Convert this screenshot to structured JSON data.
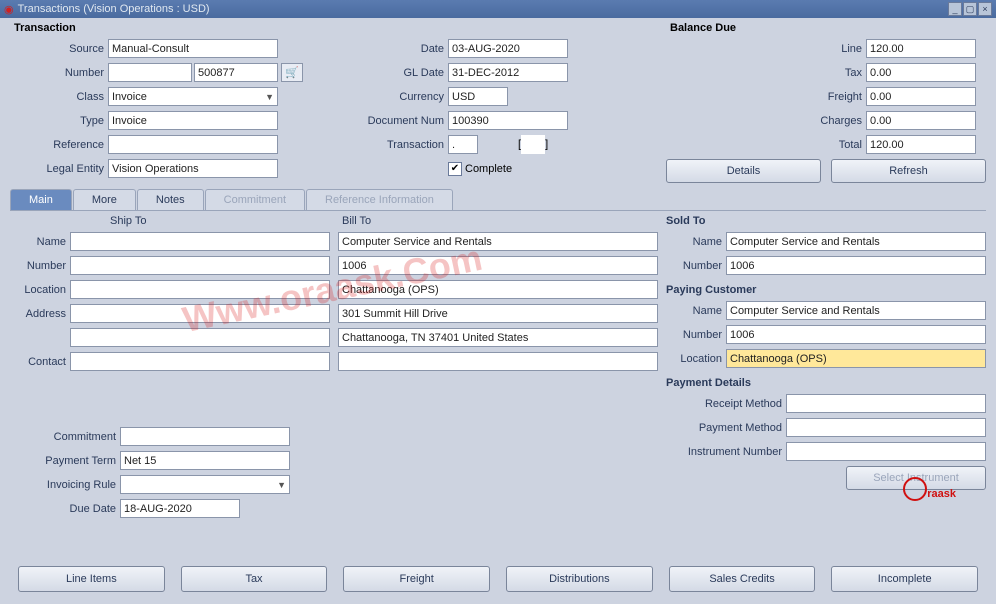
{
  "window": {
    "title": "Transactions (Vision Operations : USD)"
  },
  "transaction": {
    "label": "Transaction",
    "source_label": "Source",
    "source": "Manual-Consult",
    "number_label": "Number",
    "number_a": "",
    "number_b": "500877",
    "class_label": "Class",
    "class": "Invoice",
    "type_label": "Type",
    "type": "Invoice",
    "reference_label": "Reference",
    "reference": "",
    "legal_entity_label": "Legal Entity",
    "legal_entity": "Vision Operations",
    "date_label": "Date",
    "date": "03-AUG-2020",
    "gl_date_label": "GL Date",
    "gl_date": "31-DEC-2012",
    "currency_label": "Currency",
    "currency": "USD",
    "doc_num_label": "Document Num",
    "doc_num": "100390",
    "trans_label": "Transaction",
    "trans_a": ".",
    "trans_b": "",
    "complete_label": "Complete"
  },
  "balance": {
    "label": "Balance Due",
    "line_label": "Line",
    "line": "120.00",
    "tax_label": "Tax",
    "tax": "0.00",
    "freight_label": "Freight",
    "freight": "0.00",
    "charges_label": "Charges",
    "charges": "0.00",
    "total_label": "Total",
    "total": "120.00",
    "details_btn": "Details",
    "refresh_btn": "Refresh"
  },
  "tabs": {
    "main": "Main",
    "more": "More",
    "notes": "Notes",
    "commitment": "Commitment",
    "reference": "Reference Information"
  },
  "ship_to": {
    "header": "Ship To",
    "name_label": "Name",
    "name": "",
    "number_label": "Number",
    "number": "",
    "location_label": "Location",
    "location": "",
    "address_label": "Address",
    "address1": "",
    "address2": "",
    "contact_label": "Contact",
    "contact": ""
  },
  "bill_to": {
    "header": "Bill To",
    "name": "Computer Service and Rentals",
    "number": "1006",
    "location": "Chattanooga (OPS)",
    "address1": "301 Summit Hill Drive",
    "address2": "Chattanooga, TN 37401 United States",
    "contact": ""
  },
  "sold_to": {
    "label": "Sold To",
    "name_label": "Name",
    "name": "Computer Service and Rentals",
    "number_label": "Number",
    "number": "1006"
  },
  "paying": {
    "label": "Paying Customer",
    "name_label": "Name",
    "name": "Computer Service and Rentals",
    "number_label": "Number",
    "number": "1006",
    "location_label": "Location",
    "location": "Chattanooga (OPS)"
  },
  "payment_details": {
    "label": "Payment Details",
    "receipt_label": "Receipt Method",
    "receipt": "",
    "payment_label": "Payment Method",
    "payment": "",
    "instrument_label": "Instrument Number",
    "instrument": "",
    "select_btn": "Select Instrument"
  },
  "commitment_row": {
    "commitment_label": "Commitment",
    "commitment": "",
    "term_label": "Payment Term",
    "term": "Net 15",
    "invoicing_label": "Invoicing Rule",
    "invoicing": "",
    "due_label": "Due Date",
    "due": "18-AUG-2020"
  },
  "buttons": {
    "line_items": "Line Items",
    "tax": "Tax",
    "freight": "Freight",
    "distributions": "Distributions",
    "sales_credits": "Sales Credits",
    "incomplete": "Incomplete"
  },
  "watermark": "Www.oraask.Com",
  "watermark2": "raask"
}
